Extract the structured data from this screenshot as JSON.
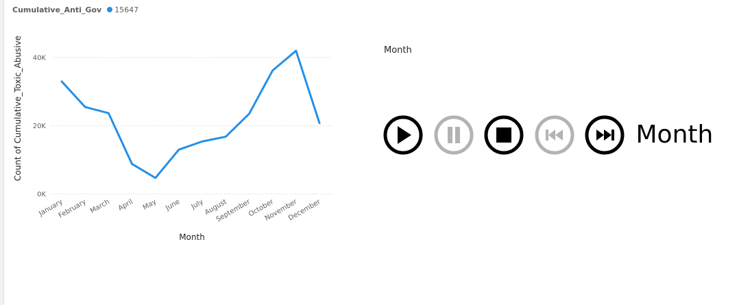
{
  "legend": {
    "title": "Cumulative_Anti_Gov",
    "series_label": "15647"
  },
  "colors": {
    "series": "#2490e8",
    "active_control": "#000000",
    "disabled_control": "#b3b3b3"
  },
  "chart_data": {
    "type": "line",
    "categories": [
      "January",
      "February",
      "March",
      "April",
      "May",
      "June",
      "July",
      "August",
      "September",
      "October",
      "November",
      "December"
    ],
    "series": [
      {
        "values": [
          33000,
          25500,
          23700,
          8800,
          4700,
          13000,
          15400,
          16800,
          23500,
          36200,
          42000,
          20800
        ]
      }
    ],
    "xlabel": "Month",
    "ylabel": "Count of Cumulative_Toxic_Abusive",
    "ylim": [
      0,
      40000
    ],
    "yticks": [
      {
        "value": 0,
        "label": "0K"
      },
      {
        "value": 20000,
        "label": "20K"
      },
      {
        "value": 40000,
        "label": "40K"
      }
    ],
    "grid": "horizontal-dotted"
  },
  "player": {
    "title": "Month",
    "label": "Month",
    "controls": [
      {
        "name": "play",
        "enabled": true,
        "icon": "play-icon"
      },
      {
        "name": "pause",
        "enabled": false,
        "icon": "pause-icon"
      },
      {
        "name": "stop",
        "enabled": true,
        "icon": "stop-icon"
      },
      {
        "name": "previous",
        "enabled": false,
        "icon": "previous-icon"
      },
      {
        "name": "next",
        "enabled": true,
        "icon": "next-icon"
      }
    ]
  }
}
